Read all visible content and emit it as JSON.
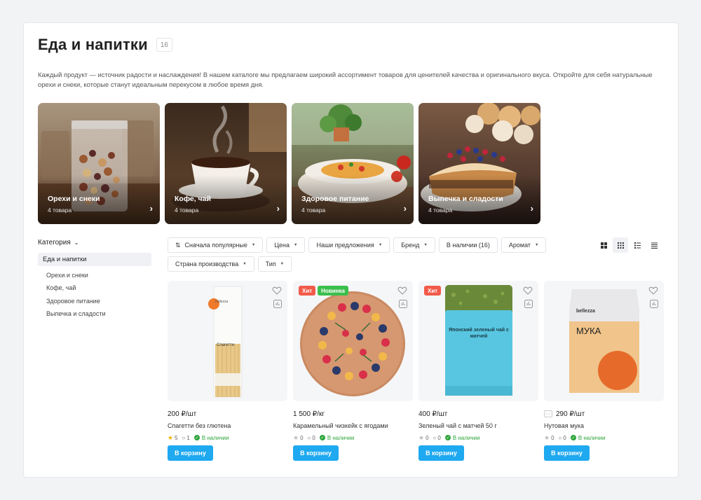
{
  "page": {
    "title": "Еда и напитки",
    "count": "16",
    "description": "Каждый продукт — источник радости и наслаждения! В нашем каталоге мы предлагаем широкий ассортимент товаров для ценителей качества и оригинального вкуса. Откройте для себя натуральные орехи и снеки, которые станут идеальным перекусом в любое время дня."
  },
  "categories": [
    {
      "name": "Орехи и снеки",
      "count": "4 товара",
      "icon": "nuts-jar-image"
    },
    {
      "name": "Кофе, чай",
      "count": "4 товара",
      "icon": "coffee-cup-image"
    },
    {
      "name": "Здоровое питание",
      "count": "4 товара",
      "icon": "pasta-bowl-image"
    },
    {
      "name": "Выпечка и сладости",
      "count": "4 товара",
      "icon": "berry-tart-image"
    }
  ],
  "sidebar": {
    "heading": "Категория",
    "active": "Еда и напитки",
    "items": [
      "Орехи и снеки",
      "Кофе, чай",
      "Здоровое питание",
      "Выпечка и сладости"
    ]
  },
  "filters": {
    "row1": [
      "Сначала популярные",
      "Цена",
      "Наши предложения",
      "Бренд",
      "В наличии (16)",
      "Аромат"
    ],
    "row2": [
      "Страна производства",
      "Тип"
    ]
  },
  "views": [
    "grid-large-icon",
    "grid-small-icon",
    "list-icon",
    "table-icon"
  ],
  "products": [
    {
      "price": "200 ₽/шт",
      "name": "Спагетти без глютена",
      "rating": "5",
      "comments": "1",
      "stock": "В наличии",
      "cta": "В корзину",
      "tags": [],
      "pack_label": "Спагетти",
      "pack_brand": "bellezza"
    },
    {
      "price": "1 500 ₽/кг",
      "name": "Карамельный чизкейк с ягодами",
      "rating": "0",
      "comments": "0",
      "stock": "В наличии",
      "cta": "В корзину",
      "tags": [
        "Хит",
        "Новинка"
      ]
    },
    {
      "price": "400 ₽/шт",
      "name": "Зеленый чай с матчей 50 г",
      "rating": "0",
      "comments": "0",
      "stock": "В наличии",
      "cta": "В корзину",
      "tags": [
        "Хит"
      ],
      "pack_label": "Японский зеленый чай с матчей"
    },
    {
      "price": "290 ₽/шт",
      "name": "Нутовая мука",
      "rating": "0",
      "comments": "0",
      "stock": "В наличии",
      "cta": "В корзину",
      "tags": [],
      "pack_label": "МУКА",
      "pack_brand": "bellezza",
      "has_more": "···"
    }
  ],
  "colors": {
    "accent": "#1ea9f0",
    "hit": "#f25b4a",
    "new": "#3bbf4c",
    "stock": "#2fa53b",
    "star": "#f4b400"
  }
}
